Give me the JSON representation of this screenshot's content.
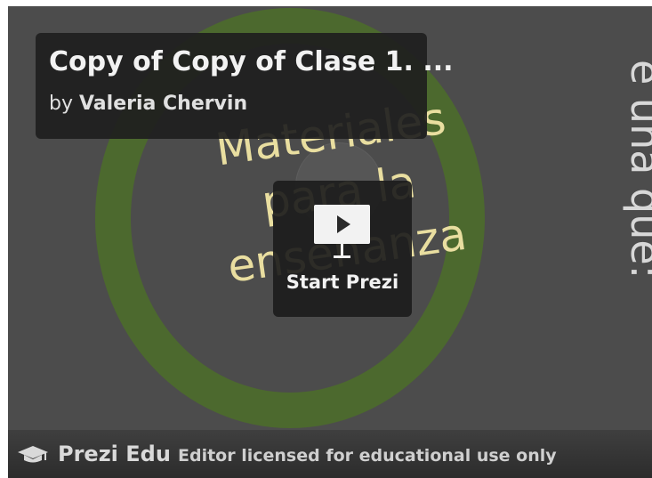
{
  "presentation": {
    "title": "Copy of Copy of Clase 1. ...",
    "author_prefix": "by",
    "author_name": "Valeria Chervin"
  },
  "canvas": {
    "main_text_line1": "Materiales",
    "main_text_line2": "para la",
    "main_text_line3": "enseñanza",
    "side_text": "e una que:",
    "ring_color": "#4c6a2c",
    "text_color": "#e9dea0"
  },
  "player": {
    "start_label": "Start Prezi",
    "play_icon": "play-icon"
  },
  "footer": {
    "icon": "graduation-cap-icon",
    "brand": "Prezi Edu",
    "license": "Editor licensed for educational use only"
  }
}
